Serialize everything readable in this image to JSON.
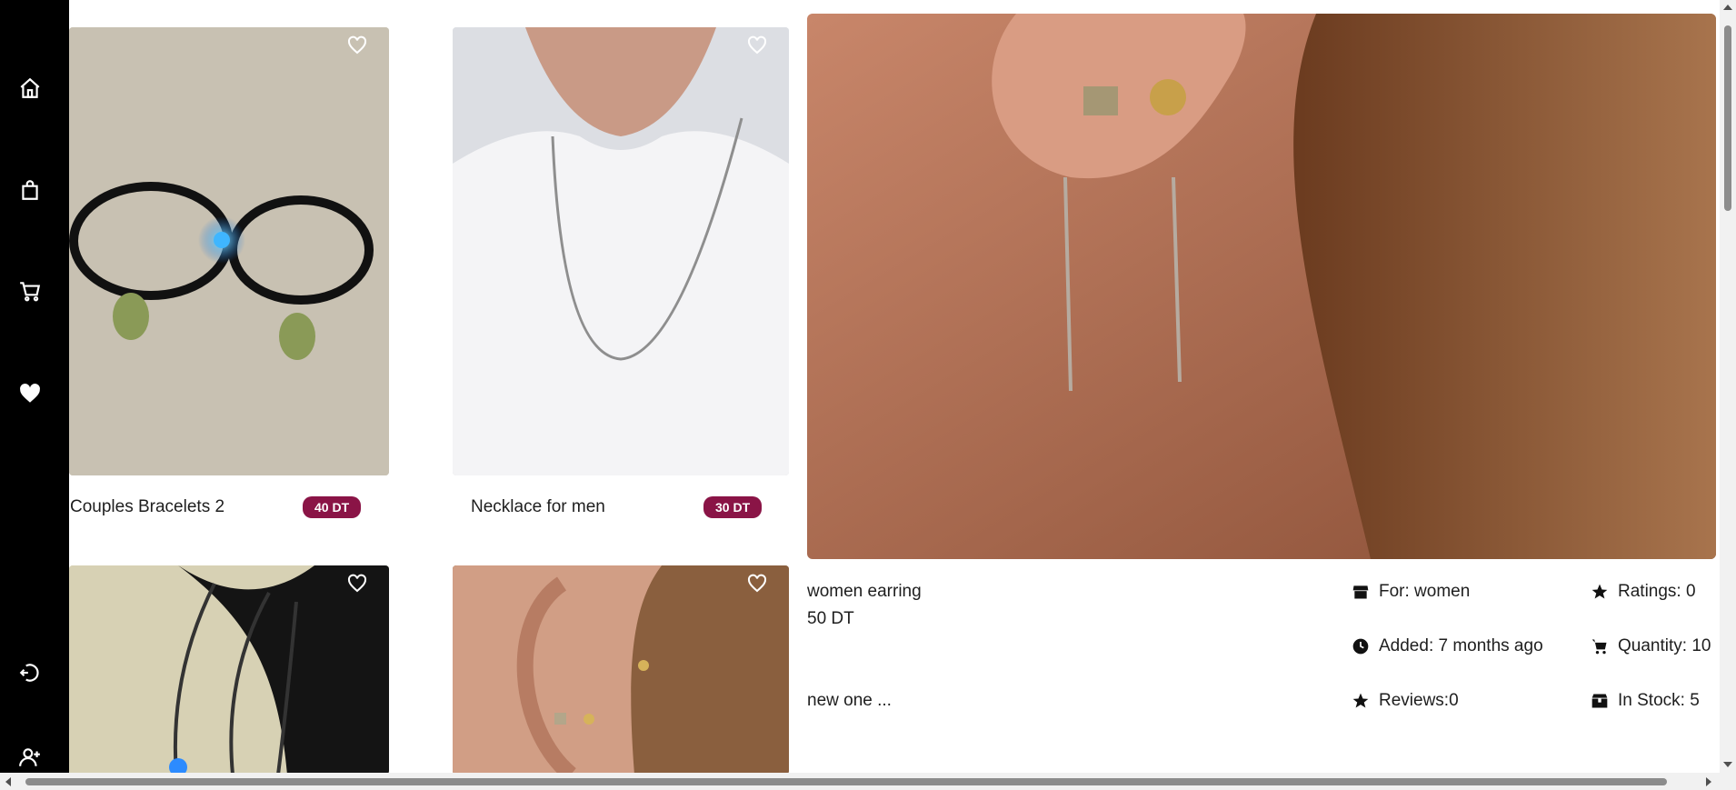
{
  "sidebar": {
    "items": [
      {
        "icon": "home-icon"
      },
      {
        "icon": "shopping-bag-icon"
      },
      {
        "icon": "cart-icon"
      },
      {
        "icon": "heart-icon"
      },
      {
        "icon": "login-icon"
      },
      {
        "icon": "add-user-icon"
      }
    ]
  },
  "products": [
    {
      "title": "Couples Bracelets 2",
      "price": "40 DT",
      "image": "bracelets-photo"
    },
    {
      "title": "Necklace for men",
      "price": "30 DT",
      "image": "necklace-photo"
    },
    {
      "title": "",
      "price": "",
      "image": "chain-necklace-photo"
    },
    {
      "title": "",
      "price": "",
      "image": "earring-photo"
    }
  ],
  "detail": {
    "name": "women earring",
    "price": "50 DT",
    "description": "new one ...",
    "for": "For: women",
    "added": "Added: 7 months ago",
    "reviews": "Reviews:0",
    "ratings": "Ratings: 0",
    "quantity": "Quantity: 10",
    "in_stock": "In Stock: 5"
  },
  "colors": {
    "sidebar_bg": "#000000",
    "price_badge": "#8a1446"
  }
}
